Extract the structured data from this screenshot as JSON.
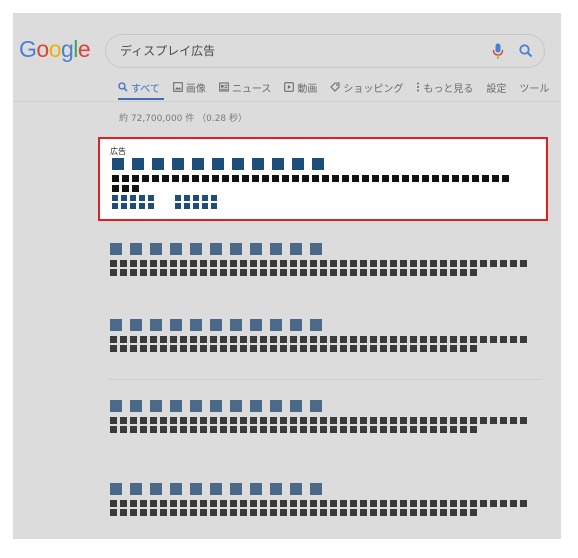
{
  "logo": {
    "text": "Google"
  },
  "search": {
    "query": "ディスプレイ広告"
  },
  "tabs": [
    {
      "label": "すべて",
      "icon": "search-icon",
      "active": true
    },
    {
      "label": "画像",
      "icon": "image-icon",
      "active": false
    },
    {
      "label": "ニュース",
      "icon": "news-icon",
      "active": false
    },
    {
      "label": "動画",
      "icon": "video-icon",
      "active": false
    },
    {
      "label": "ショッピング",
      "icon": "tag-icon",
      "active": false
    },
    {
      "label": "もっと見る",
      "icon": "more-icon",
      "active": false
    },
    {
      "label": "設定",
      "icon": "",
      "active": false
    },
    {
      "label": "ツール",
      "icon": "",
      "active": false
    }
  ],
  "stats": {
    "text": "約 72,700,000 件 （0.28 秒）"
  },
  "ad": {
    "label": "広告"
  },
  "colors": {
    "background": "#dcdcdc",
    "ad_border": "#e02020",
    "ad_title": "#1d4e7a",
    "ad_text": "#111111",
    "result_title": "#4b6a8a",
    "result_text": "#3a3a3a",
    "accent": "#3d6dbf"
  },
  "results": [
    {
      "kind": "organic-result"
    },
    {
      "kind": "organic-result"
    },
    {
      "kind": "organic-result"
    },
    {
      "kind": "organic-result"
    }
  ]
}
